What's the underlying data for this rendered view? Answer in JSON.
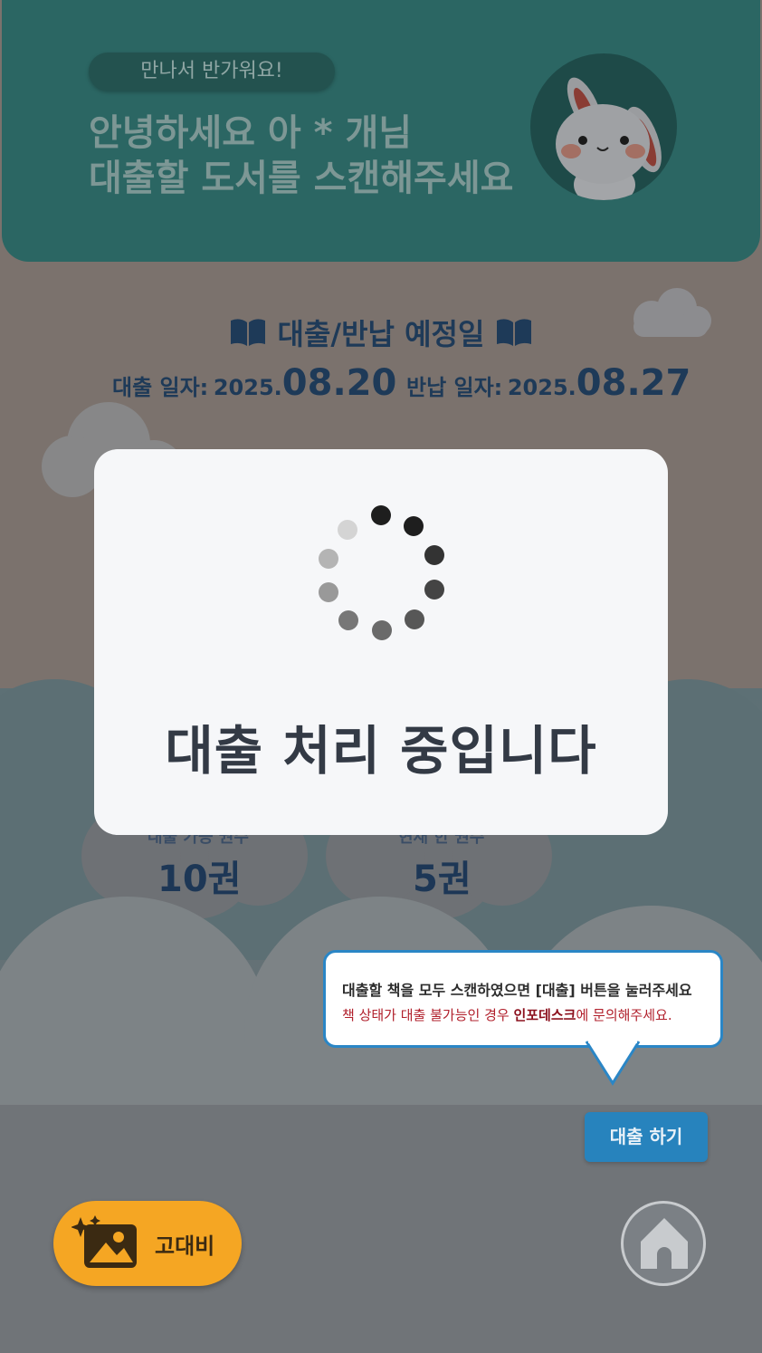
{
  "header": {
    "greeting_pill": "만나서 반가워요!",
    "hello_line1": "안녕하세요 아 * 개님",
    "hello_line2": "대출할 도서를 스캔해주세요"
  },
  "schedule": {
    "title": "대출/반납 예정일",
    "loan_label": "대출 일자:",
    "loan_year": "2025.",
    "loan_md": "08.20",
    "return_label": "반납 일자:",
    "return_year": "2025.",
    "return_md": "08.27"
  },
  "counts": {
    "available_label": "대출 가능 권수",
    "available_value": "10권",
    "current_label": "현재 한 권수",
    "current_value": "5권"
  },
  "tooltip": {
    "line1": "대출할 책을 모두 스캔하였으면 [대출] 버튼을 눌러주세요",
    "line2_pre": "책 상태가 대출 불가능인 경우 ",
    "line2_bold": "인포데스크",
    "line2_post": "에 문의해주세요."
  },
  "buttons": {
    "loan": "대출 하기",
    "contrast": "고대비"
  },
  "modal": {
    "message": "대출 처리 중입니다"
  },
  "icons": {
    "book": "book-open-icon",
    "contrast": "image-sparkle-icon",
    "home": "home-icon",
    "mascot": "bunny-mascot"
  },
  "colors": {
    "header": "#2b6663",
    "accent_blue": "#2783bd",
    "contrast_orange": "#f5a623",
    "warning_red": "#b1202c"
  }
}
